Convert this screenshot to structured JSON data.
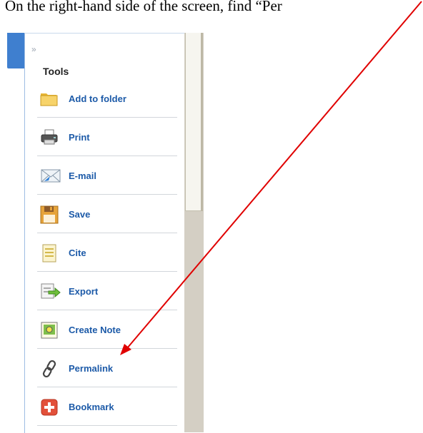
{
  "instruction": "On the right-hand side of the screen, find “Per",
  "panel": {
    "collapse_glyph": "»",
    "title": "Tools",
    "items": [
      {
        "label": "Add to folder",
        "icon": "folder-icon"
      },
      {
        "label": "Print",
        "icon": "printer-icon"
      },
      {
        "label": "E-mail",
        "icon": "email-icon"
      },
      {
        "label": "Save",
        "icon": "floppy-disk-icon"
      },
      {
        "label": "Cite",
        "icon": "document-icon"
      },
      {
        "label": "Export",
        "icon": "export-icon"
      },
      {
        "label": "Create Note",
        "icon": "note-icon"
      },
      {
        "label": "Permalink",
        "icon": "chain-link-icon"
      },
      {
        "label": "Bookmark",
        "icon": "bookmark-plus-icon"
      }
    ]
  },
  "colors": {
    "annotation_arrow": "#e00000",
    "item_label": "#1c5aa8",
    "panel_tab": "#3f7fcf"
  }
}
